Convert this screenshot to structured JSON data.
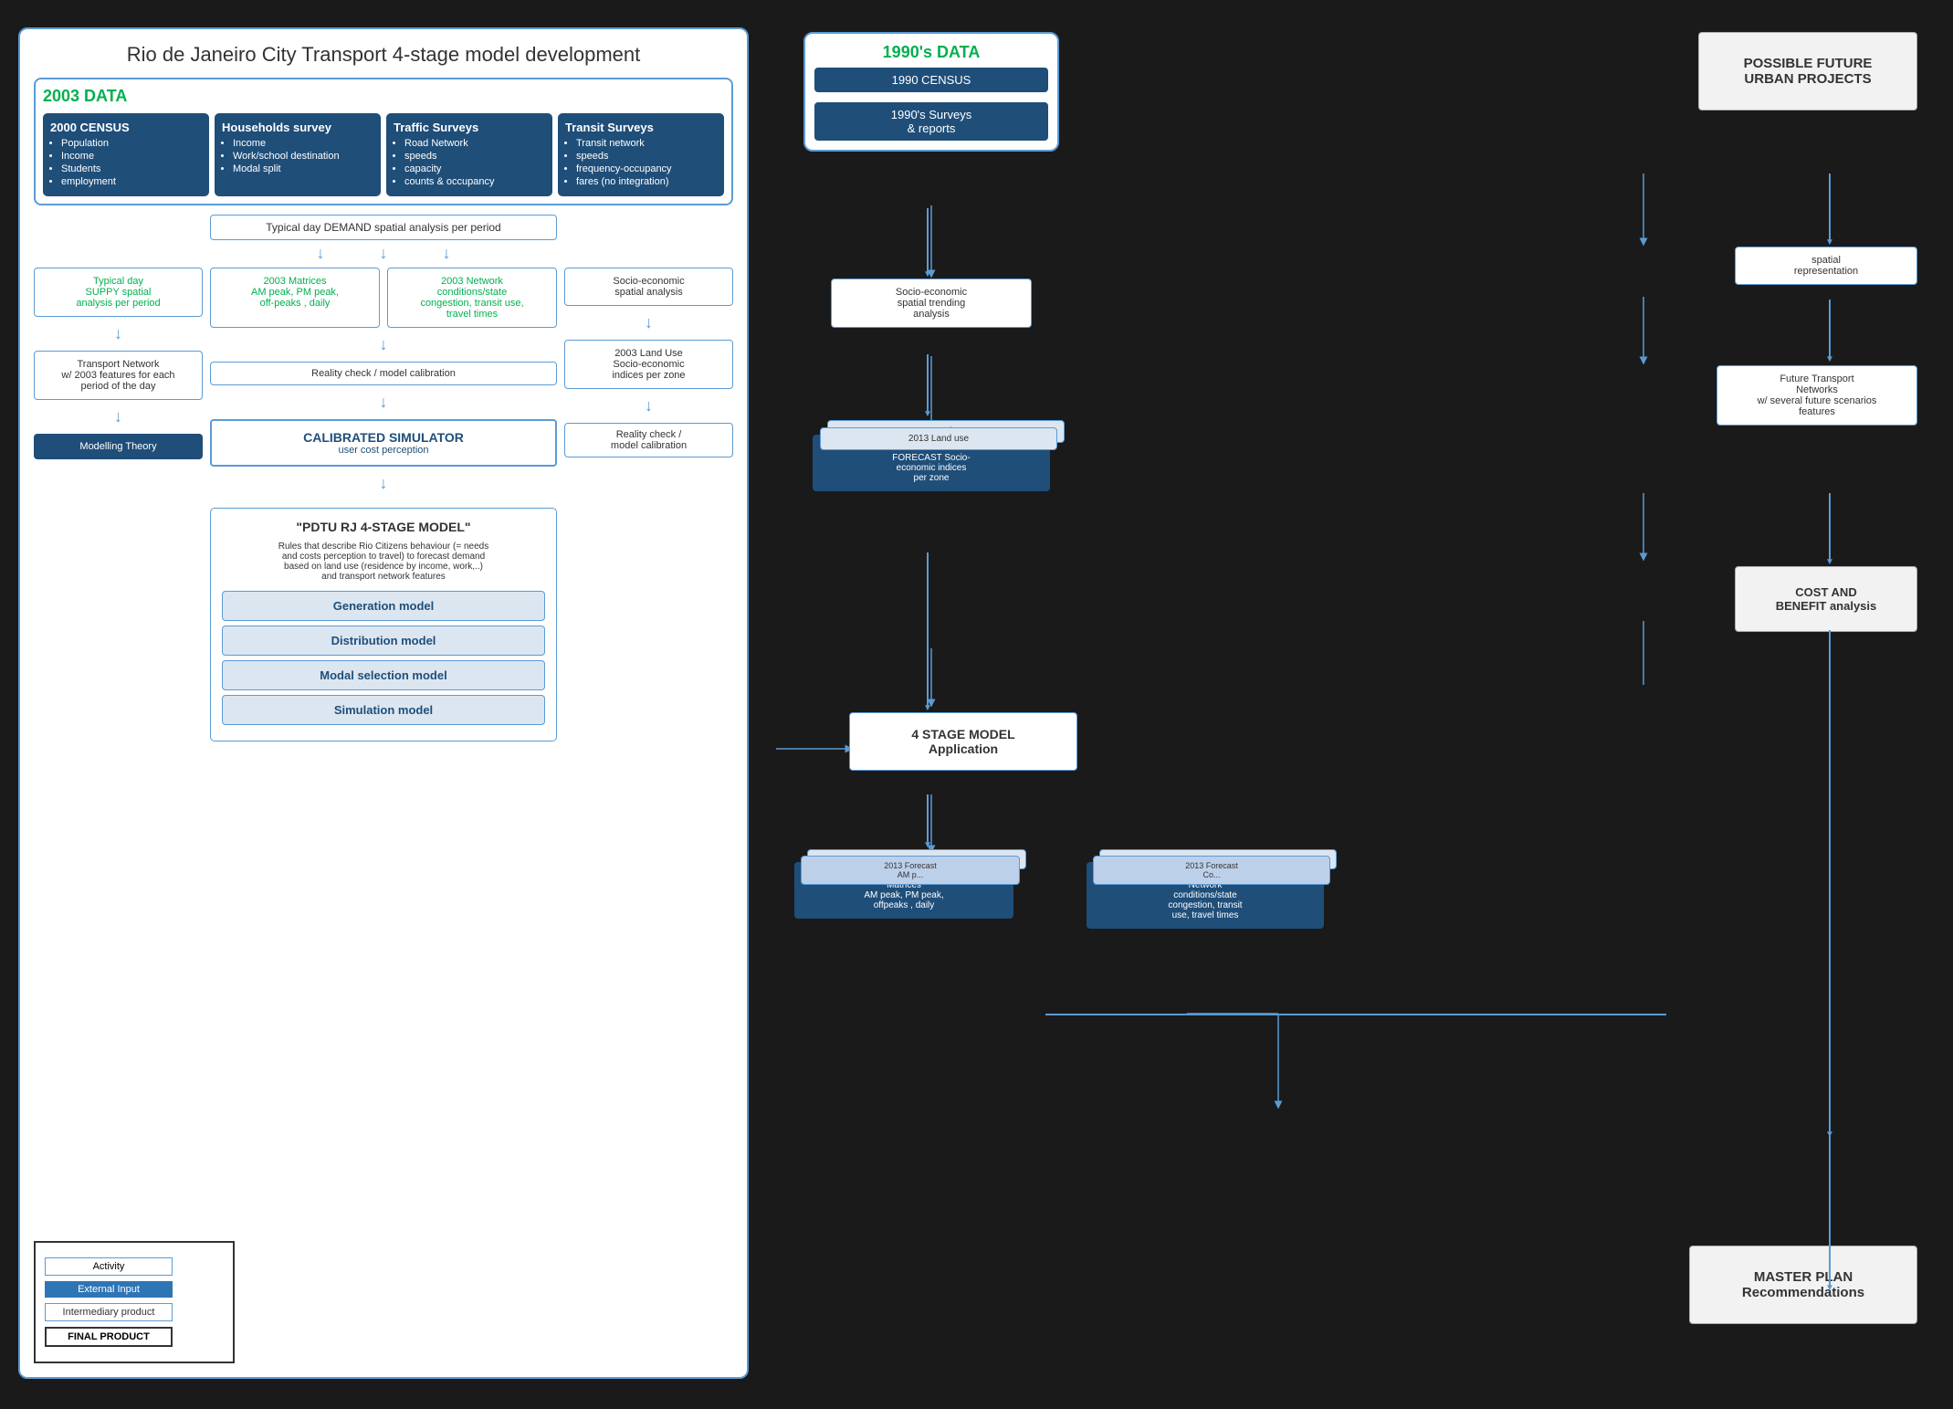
{
  "page": {
    "background": "#1a1a1a"
  },
  "left_panel": {
    "title": "Rio de Janeiro City Transport 4-stage model  development",
    "data_2003": {
      "label": "2003 DATA",
      "cards": [
        {
          "title": "2000 CENSUS",
          "items": [
            "Population",
            "Income",
            "Students",
            "employment"
          ]
        },
        {
          "title": "Households survey",
          "items": [
            "Income",
            "Work/school destination",
            "Modal split"
          ]
        },
        {
          "title": "Traffic Surveys",
          "items": [
            "Road Network",
            "speeds",
            "capacity",
            "counts & occupancy"
          ]
        },
        {
          "title": "Transit Surveys",
          "items": [
            "Transit network",
            "speeds",
            "frequency-occupancy",
            "fares (no integration)"
          ]
        }
      ]
    },
    "typical_day_demand": "Typical day DEMAND spatial  analysis per period",
    "typical_day_supply": "Typical day\nSUPPY spatial\nanalysis per period",
    "matrices_2003": "2003 Matrices\nAM peak, PM peak,\noff-peaks , daily",
    "network_2003": "2003 Network\nconditions/state\ncongestion, transit use,\ntravel times",
    "socio_economic": "Socio-economic\nspatial analysis",
    "transport_network": "Transport Network\nw/ 2003 features for each\nperiod of the day",
    "reality_check_1": "Reality check / model calibration",
    "land_use_2003": "2003 Land Use\nSocio-economic\nindices per zone",
    "calibrated_simulator": "CALIBRATED SIMULATOR\nuser cost perception",
    "reality_check_2": "Reality check /\nmodel calibration",
    "modelling_theory": "Modelling Theory",
    "pdtu": {
      "title": "\"PDTU RJ 4-STAGE MODEL\"",
      "desc": "Rules that describe Rio Citizens behaviour (= needs\nand costs perception to travel) to forecast demand\nbased on land use (residence by income, work,..)\nand transport network features",
      "models": [
        "Generation model",
        "Distribution model",
        "Modal selection model",
        "Simulation model"
      ]
    },
    "legend": {
      "activity": "Activity",
      "external_input": "External Input",
      "intermediary_product": "Intermediary product",
      "final_product": "FINAL PRODUCT"
    }
  },
  "right_panel": {
    "data_1990s": {
      "label": "1990's DATA",
      "census": "1990 CENSUS",
      "surveys": "1990's Surveys\n& reports"
    },
    "future_projects": "POSSIBLE FUTURE\nURBAN PROJECTS",
    "socio_trending": "Socio-economic\nspatial trending\nanalysis",
    "spatial_representation": "spatial\nrepresentation",
    "land_use_stack": {
      "top": "... Land Use",
      "mid1": "2013 Land use",
      "mid2": "2008 Land Use\nFORECAST Socio-\neconomic indices\nper zone"
    },
    "future_networks": "Future Transport\nNetworks\nw/ several future scenarios\nfeatures",
    "stage_model": "4 STAGE MODEL\nApplication",
    "cost_benefit": "COST AND\nBENEFIT analysis",
    "forecast_matrices": {
      "back2": "... Forecast",
      "back1": "2013 Forecast\nAM p...",
      "front": "2008 Forecast\nMatrices\nAM peak, PM peak,\noffpeaks , daily"
    },
    "forecast_network": {
      "back2": "... Forecast",
      "back1": "2013 Forecast\nCo...",
      "front": "2008 Forecast\nNetwork\nconditions/state\ncongestion, transit\nuse, travel times"
    },
    "master_plan": "MASTER PLAN\nRecommendations"
  }
}
